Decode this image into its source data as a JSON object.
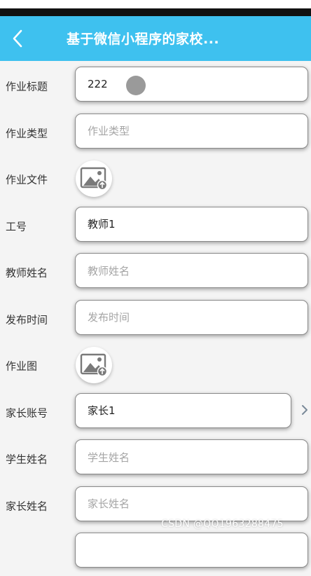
{
  "app": {
    "title": "基于微信小程序的家校..."
  },
  "form": {
    "title_label": "作业标题",
    "title_value": "222",
    "type_label": "作业类型",
    "type_placeholder": "作业类型",
    "file_label": "作业文件",
    "file_icon": "image-upload-icon",
    "job_no_label": "工号",
    "job_no_value": "教师1",
    "teacher_name_label": "教师姓名",
    "teacher_name_placeholder": "教师姓名",
    "publish_time_label": "发布时间",
    "publish_time_placeholder": "发布时间",
    "image_label": "作业图",
    "image_icon": "image-upload-icon",
    "parent_account_label": "家长账号",
    "parent_account_value": "家长1",
    "student_name_label": "学生姓名",
    "student_name_placeholder": "学生姓名",
    "parent_name_label": "家长姓名",
    "parent_name_placeholder": "家长姓名"
  },
  "watermark": "CSDN @QQ1963288475",
  "colors": {
    "navbar": "#3ec1ef",
    "placeholder": "#a5a5a5"
  }
}
